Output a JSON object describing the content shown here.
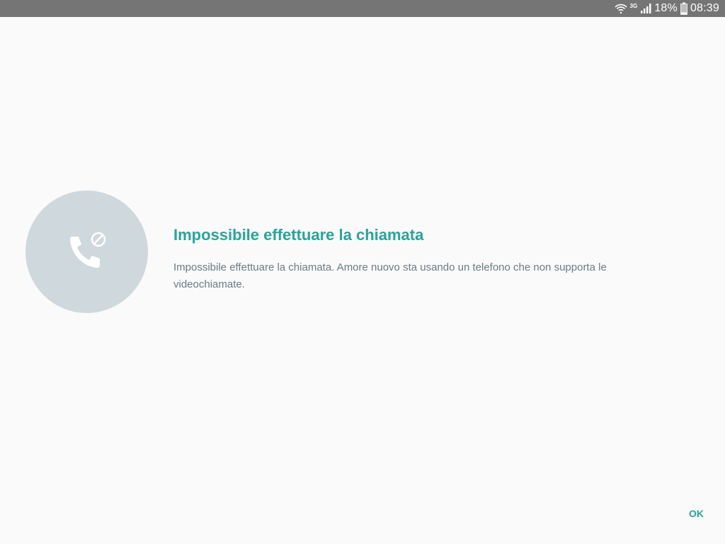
{
  "status_bar": {
    "network_type": "3G",
    "battery_percent": "18%",
    "time": "08:39",
    "icons": [
      "wifi-icon",
      "network-3g-icon",
      "signal-icon",
      "battery-icon"
    ]
  },
  "dialog": {
    "icon": "call-blocked-icon",
    "title": "Impossibile effettuare la chiamata",
    "message": "Impossibile effettuare la chiamata. Amore nuovo sta usando un telefono che non supporta le videochiamate.",
    "ok_label": "OK"
  },
  "colors": {
    "accent": "#26a69a",
    "status_bar": "#757575",
    "avatar_bg": "#cfd8dc",
    "message_text": "#6b7b84",
    "background": "#fafafa"
  }
}
